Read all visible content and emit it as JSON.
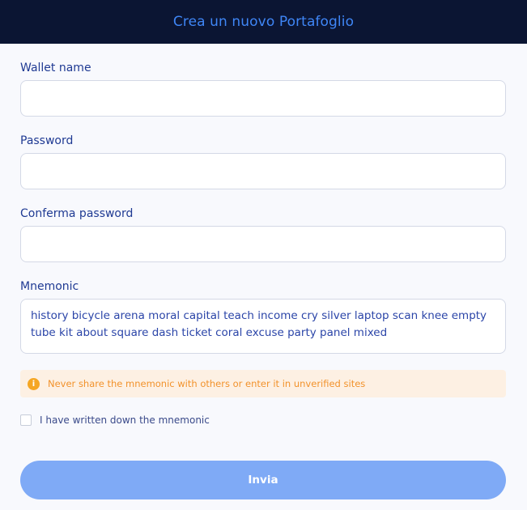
{
  "header": {
    "title": "Crea un nuovo Portafoglio"
  },
  "form": {
    "wallet_name": {
      "label": "Wallet name",
      "value": ""
    },
    "password": {
      "label": "Password",
      "value": ""
    },
    "confirm_password": {
      "label": "Conferma password",
      "value": ""
    },
    "mnemonic": {
      "label": "Mnemonic",
      "value": "history bicycle arena moral capital teach income cry silver laptop scan knee empty tube kit about square dash ticket coral excuse party panel mixed"
    },
    "warning": {
      "icon": "info-icon",
      "icon_glyph": "i",
      "text": "Never share the mnemonic with others or enter it in unverified sites"
    },
    "confirmation_checkbox": {
      "label": "I have written down the mnemonic",
      "checked": false
    },
    "submit_label": "Invia"
  },
  "colors": {
    "header_bg": "#0b1533",
    "accent": "#3f86f6",
    "button_bg": "#7faaf6",
    "warning_bg": "#fdf0e3",
    "warning_text": "#f2922b",
    "label_text": "#1f3a93"
  }
}
